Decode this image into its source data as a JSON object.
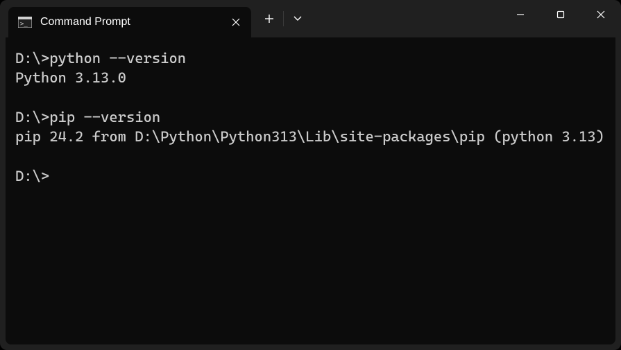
{
  "tab": {
    "title": "Command Prompt",
    "icon": "cmd-icon"
  },
  "terminal": {
    "lines": [
      {
        "prompt": "D:\\>",
        "cmd": "python --version"
      },
      {
        "out": "Python 3.13.0"
      },
      {
        "blank": true
      },
      {
        "prompt": "D:\\>",
        "cmd": "pip --version"
      },
      {
        "out": "pip 24.2 from D:\\Python\\Python313\\Lib\\site-packages\\pip (python 3.13)"
      },
      {
        "blank": true
      },
      {
        "prompt": "D:\\>",
        "cmd": ""
      }
    ]
  }
}
